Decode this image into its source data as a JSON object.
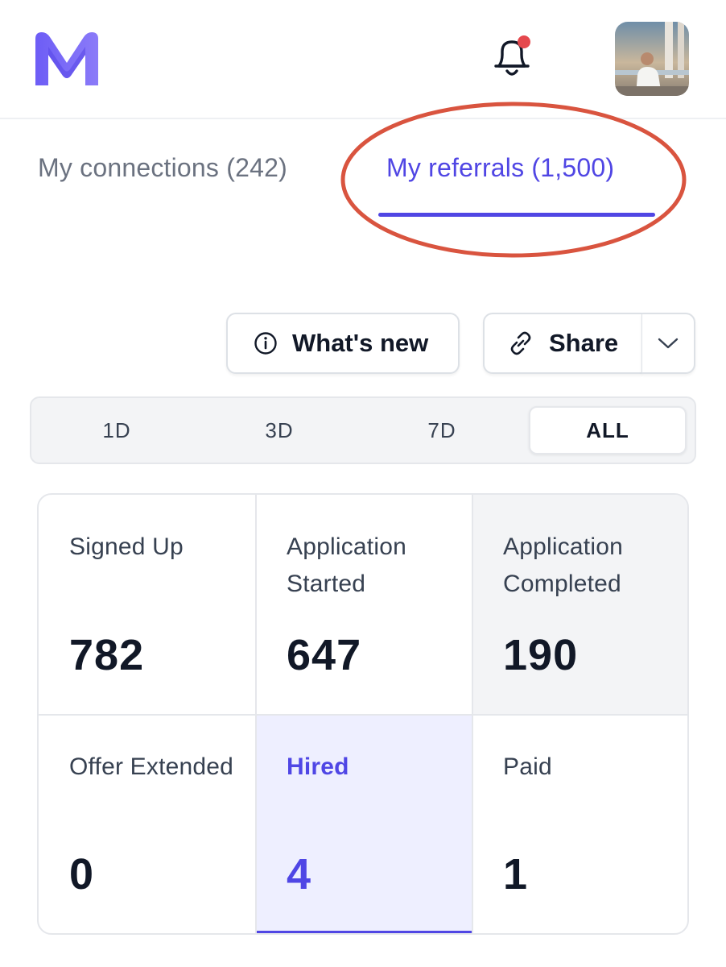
{
  "header": {
    "logo_letter": "M",
    "notification_dot_color": "#e5484d",
    "avatar_alt": "avatar"
  },
  "tabs": [
    {
      "label": "My connections (242)",
      "active": false
    },
    {
      "label": "My referrals (1,500)",
      "active": true
    }
  ],
  "actions": {
    "whats_new_label": "What's new",
    "share_label": "Share"
  },
  "time_range": {
    "options": [
      "1D",
      "3D",
      "7D",
      "ALL"
    ],
    "selected": "ALL"
  },
  "stats": [
    {
      "label": "Signed Up",
      "value": "782"
    },
    {
      "label": "Application Started",
      "value": "647"
    },
    {
      "label": "Application Completed",
      "value": "190"
    },
    {
      "label": "Offer Extended",
      "value": "0"
    },
    {
      "label": "Hired",
      "value": "4",
      "active": true
    },
    {
      "label": "Paid",
      "value": "1"
    }
  ],
  "colors": {
    "accent": "#5046e4",
    "annotation": "#d9543f",
    "text_dark": "#111827",
    "text_muted": "#6b7280"
  }
}
